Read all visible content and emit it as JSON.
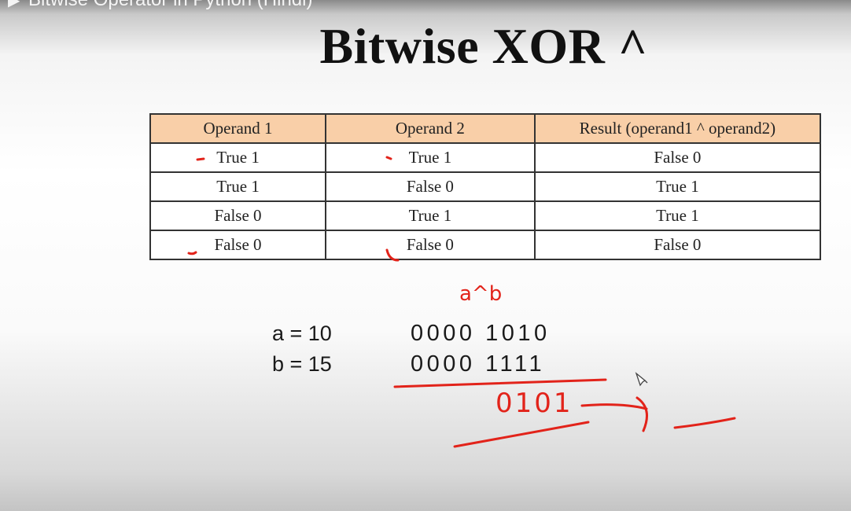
{
  "video": {
    "title": "Bitwise Operator in Python (Hindi)"
  },
  "slide": {
    "title": "Bitwise XOR ^",
    "table": {
      "headers": [
        "Operand 1",
        "Operand 2",
        "Result (operand1 ^ operand2)"
      ],
      "rows": [
        [
          "True 1",
          "True 1",
          "False 0"
        ],
        [
          "True 1",
          "False 0",
          "True 1"
        ],
        [
          "False 0",
          "True 1",
          "True 1"
        ],
        [
          "False 0",
          "False 0",
          "False 0"
        ]
      ]
    },
    "example": {
      "a_label": "a = 10",
      "b_label": "b = 15",
      "a_binary": "0000 1010",
      "b_binary": "0000 1111"
    }
  },
  "annotations": {
    "expression": "a^b",
    "result": "0101",
    "ink_color": "#e2231a"
  }
}
